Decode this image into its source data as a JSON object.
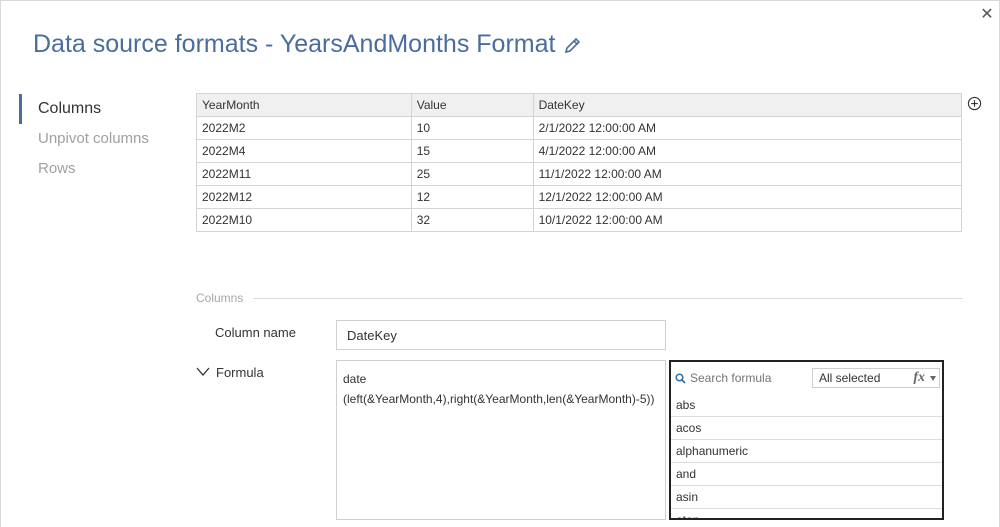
{
  "dialog": {
    "title": "Data source formats - YearsAndMonths Format"
  },
  "sidebar": {
    "items": [
      {
        "label": "Columns",
        "active": true
      },
      {
        "label": "Unpivot columns",
        "active": false
      },
      {
        "label": "Rows",
        "active": false
      }
    ]
  },
  "grid": {
    "headers": [
      "YearMonth",
      "Value",
      "DateKey"
    ],
    "rows": [
      [
        "2022M2",
        "10",
        "2/1/2022 12:00:00 AM"
      ],
      [
        "2022M4",
        "15",
        "4/1/2022 12:00:00 AM"
      ],
      [
        "2022M11",
        "25",
        "11/1/2022 12:00:00 AM"
      ],
      [
        "2022M12",
        "12",
        "12/1/2022 12:00:00 AM"
      ],
      [
        "2022M10",
        "32",
        "10/1/2022 12:00:00 AM"
      ]
    ]
  },
  "columns_section": {
    "label": "Columns",
    "column_name_label": "Column name",
    "column_name_value": "DateKey",
    "formula_label": "Formula",
    "formula_value": "date\n(left(&YearMonth,4),right(&YearMonth,len(&YearMonth)-5))"
  },
  "formula_panel": {
    "search_placeholder": "Search formula",
    "filter_value": "All selected",
    "fx_symbol": "fx",
    "functions": [
      "abs",
      "acos",
      "alphanumeric",
      "and",
      "asin",
      "atan"
    ]
  },
  "colors": {
    "title": "#4a6d9e",
    "accent": "#4a6d9e"
  },
  "icons": {
    "close": "close-icon",
    "edit": "pencil-icon",
    "add": "plus-circle-icon",
    "expand": "chevron-down-icon",
    "search": "search-icon"
  }
}
